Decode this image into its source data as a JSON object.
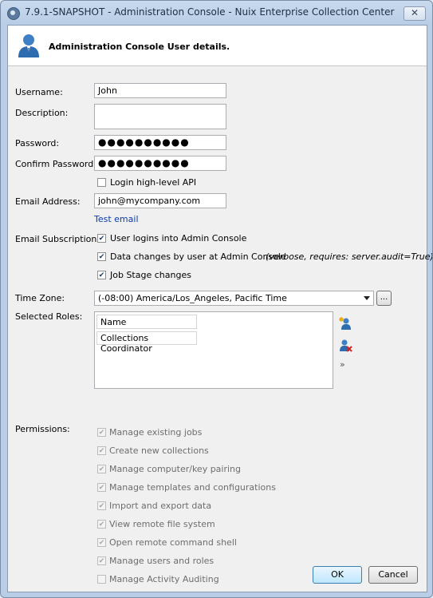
{
  "window": {
    "title": "7.9.1-SNAPSHOT - Administration Console - Nuix Enterprise Collection Center",
    "close_label": "✕"
  },
  "header": {
    "title": "Administration Console User details."
  },
  "form": {
    "username_label": "Username:",
    "username_value": "John",
    "description_label": "Description:",
    "description_value": "",
    "password_label": "Password:",
    "password_value": "●●●●●●●●●●",
    "confirm_label": "Confirm Password:",
    "confirm_value": "●●●●●●●●●●",
    "login_api_label": "Login high-level API",
    "email_label": "Email Address:",
    "email_value": "john@mycompany.com",
    "test_email_link": "Test email",
    "subscriptions_label": "Email Subscriptions:",
    "subscriptions": [
      {
        "label": "User logins into Admin Console",
        "note": "",
        "checked": true
      },
      {
        "label": "Data changes by user at Admin Console",
        "note": "(verbose, requires: server.audit=True)",
        "checked": true
      },
      {
        "label": "Job Stage changes",
        "note": "",
        "checked": true
      }
    ],
    "timezone_label": "Time Zone:",
    "timezone_value": "(-08:00) America/Los_Angeles, Pacific Time",
    "timezone_more": "...",
    "roles_label": "Selected Roles:",
    "roles_column": "Name",
    "roles": [
      "Collections Coordinator"
    ],
    "roles_expand": "»",
    "permissions_label": "Permissions:",
    "permissions": [
      {
        "label": "Manage existing jobs",
        "checked": true
      },
      {
        "label": "Create new collections",
        "checked": true
      },
      {
        "label": "Manage computer/key pairing",
        "checked": true
      },
      {
        "label": "Manage templates and configurations",
        "checked": true
      },
      {
        "label": "Import and export data",
        "checked": true
      },
      {
        "label": "View remote file system",
        "checked": true
      },
      {
        "label": "Open remote command shell",
        "checked": true
      },
      {
        "label": "Manage users and roles",
        "checked": true
      },
      {
        "label": "Manage Activity Auditing",
        "checked": false
      }
    ]
  },
  "buttons": {
    "ok": "OK",
    "cancel": "Cancel"
  },
  "colors": {
    "link": "#0a3aa8",
    "titlebar": "#c9daee",
    "default_button": "#bee6fd"
  }
}
